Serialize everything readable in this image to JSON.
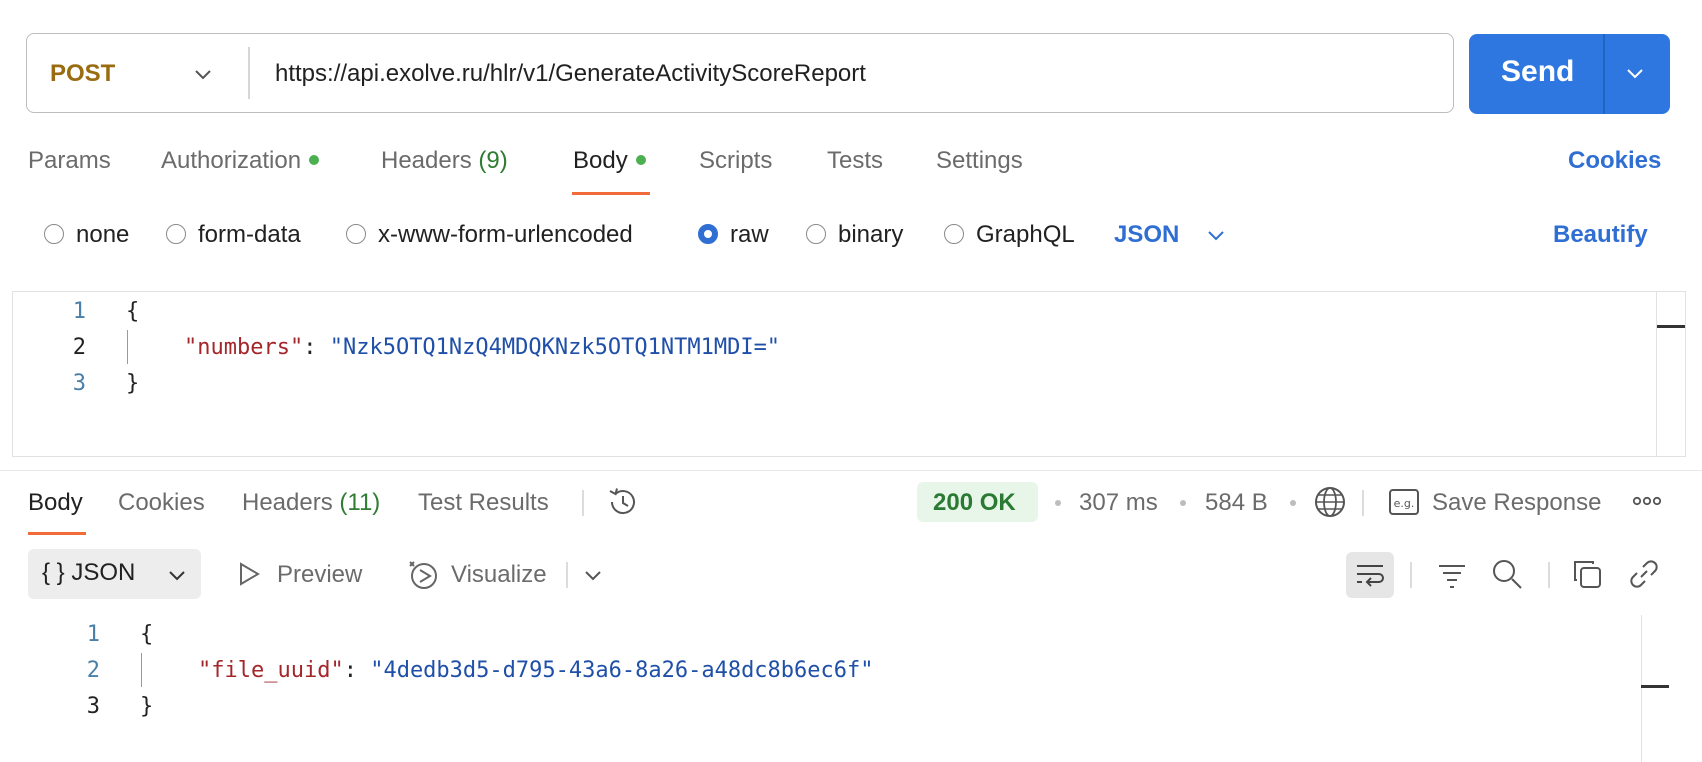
{
  "request": {
    "method": "POST",
    "url": "https://api.exolve.ru/hlr/v1/GenerateActivityScoreReport",
    "send_label": "Send"
  },
  "request_tabs": [
    {
      "label": "Params"
    },
    {
      "label": "Authorization"
    },
    {
      "label": "Headers",
      "count": "(9)"
    },
    {
      "label": "Body"
    },
    {
      "label": "Scripts"
    },
    {
      "label": "Tests"
    },
    {
      "label": "Settings"
    }
  ],
  "cookies_label": "Cookies",
  "body_types": [
    "none",
    "form-data",
    "x-www-form-urlencoded",
    "raw",
    "binary",
    "GraphQL"
  ],
  "body_selected": "raw",
  "body_language": "JSON",
  "beautify_label": "Beautify",
  "request_editor": {
    "line_numbers": [
      "1",
      "2",
      "3"
    ],
    "open_brace": "{",
    "key": "\"numbers\"",
    "colon": ": ",
    "value": "\"Nzk5OTQ1NzQ4MDQKNzk5OTQ1NTM1MDI=\"",
    "close_brace": "}"
  },
  "response_tabs": [
    {
      "label": "Body"
    },
    {
      "label": "Cookies"
    },
    {
      "label": "Headers",
      "count": "(11)"
    },
    {
      "label": "Test Results"
    }
  ],
  "response_meta": {
    "status": "200 OK",
    "time": "307 ms",
    "size": "584 B",
    "save_label": "Save Response",
    "status_color": "#2a7a33"
  },
  "response_toolbar": {
    "format": "JSON",
    "preview": "Preview",
    "visualize": "Visualize"
  },
  "response_editor": {
    "line_numbers": [
      "1",
      "2",
      "3"
    ],
    "open_brace": "{",
    "key": "\"file_uuid\"",
    "colon": ": ",
    "value": "\"4dedb3d5-d795-43a6-8a26-a48dc8b6ec6f\"",
    "close_brace": "}"
  },
  "colors": {
    "accent": "#2f77e0",
    "method": "#9a6c12",
    "tab_underline": "#f26b3a",
    "json_key": "#a3262a",
    "json_string": "#1f4fa8"
  }
}
